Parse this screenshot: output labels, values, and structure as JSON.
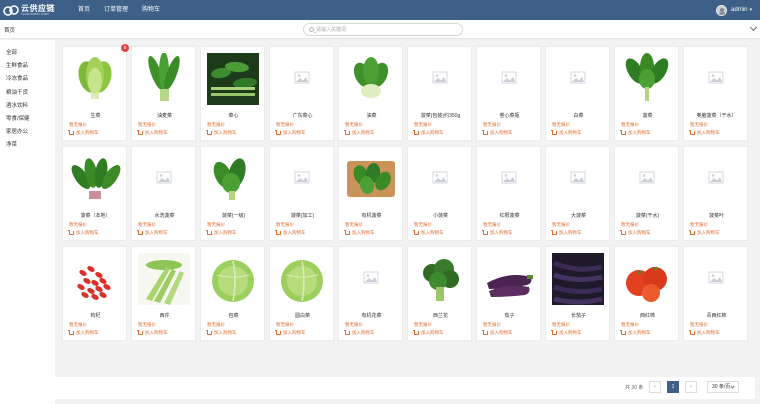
{
  "app": {
    "logo_title": "云供应链",
    "logo_sub": "CLOUD SUPPLY CHAIN",
    "nav": [
      "首页",
      "订单管理",
      "购物车"
    ],
    "user": "admin"
  },
  "breadcrumb": "首页",
  "search": {
    "placeholder": "请输入关键词",
    "value": ""
  },
  "categories": [
    "全部",
    "生鲜食品",
    "冷冻食品",
    "粮油干货",
    "酒水饮料",
    "零食/保健",
    "家居办公",
    "净菜"
  ],
  "card_labels": {
    "price": "暂无报价",
    "cart": "加入购物车"
  },
  "cart_badge": "5",
  "products": [
    {
      "name": "生菜",
      "img": "lettuce"
    },
    {
      "name": "油麦菜",
      "img": "youmai"
    },
    {
      "name": "菜心",
      "img": "caixin"
    },
    {
      "name": "广东菜心",
      "img": "placeholder"
    },
    {
      "name": "油菜",
      "img": "bokchoy"
    },
    {
      "name": "菠菜(包装)约350g",
      "img": "placeholder"
    },
    {
      "name": "卷心菜瓶",
      "img": "placeholder"
    },
    {
      "name": "白菜",
      "img": "placeholder"
    },
    {
      "name": "菠菜",
      "img": "spinach"
    },
    {
      "name": "奥脑菠菜（干水）",
      "img": "placeholder"
    },
    {
      "name": "菠菜（本地）",
      "img": "spinach2"
    },
    {
      "name": "水洗菠菜",
      "img": "placeholder"
    },
    {
      "name": "菠菜(一级)",
      "img": "spinach3"
    },
    {
      "name": "菠菜(加工)",
      "img": "placeholder"
    },
    {
      "name": "有机菠菜",
      "img": "organicspinach"
    },
    {
      "name": "小菠菜",
      "img": "placeholder"
    },
    {
      "name": "红根菠菜",
      "img": "placeholder"
    },
    {
      "name": "大菠菜",
      "img": "placeholder"
    },
    {
      "name": "菠菜(干水)",
      "img": "placeholder"
    },
    {
      "name": "菠菜叶",
      "img": "placeholder"
    },
    {
      "name": "枸杞",
      "img": "goji"
    },
    {
      "name": "西芹",
      "img": "celery"
    },
    {
      "name": "包菜",
      "img": "cabbage"
    },
    {
      "name": "圆白菜",
      "img": "cabbage"
    },
    {
      "name": "有机花菜",
      "img": "placeholder"
    },
    {
      "name": "西兰花",
      "img": "broccoli"
    },
    {
      "name": "茄子",
      "img": "eggplant"
    },
    {
      "name": "长茄子",
      "img": "longeggplant"
    },
    {
      "name": "西红柿",
      "img": "tomato"
    },
    {
      "name": "青西红柿",
      "img": "placeholder"
    }
  ],
  "pagination": {
    "total": "共 30 条",
    "prev": "‹",
    "current": "1",
    "next": "›",
    "page_size": "30 条/页"
  }
}
